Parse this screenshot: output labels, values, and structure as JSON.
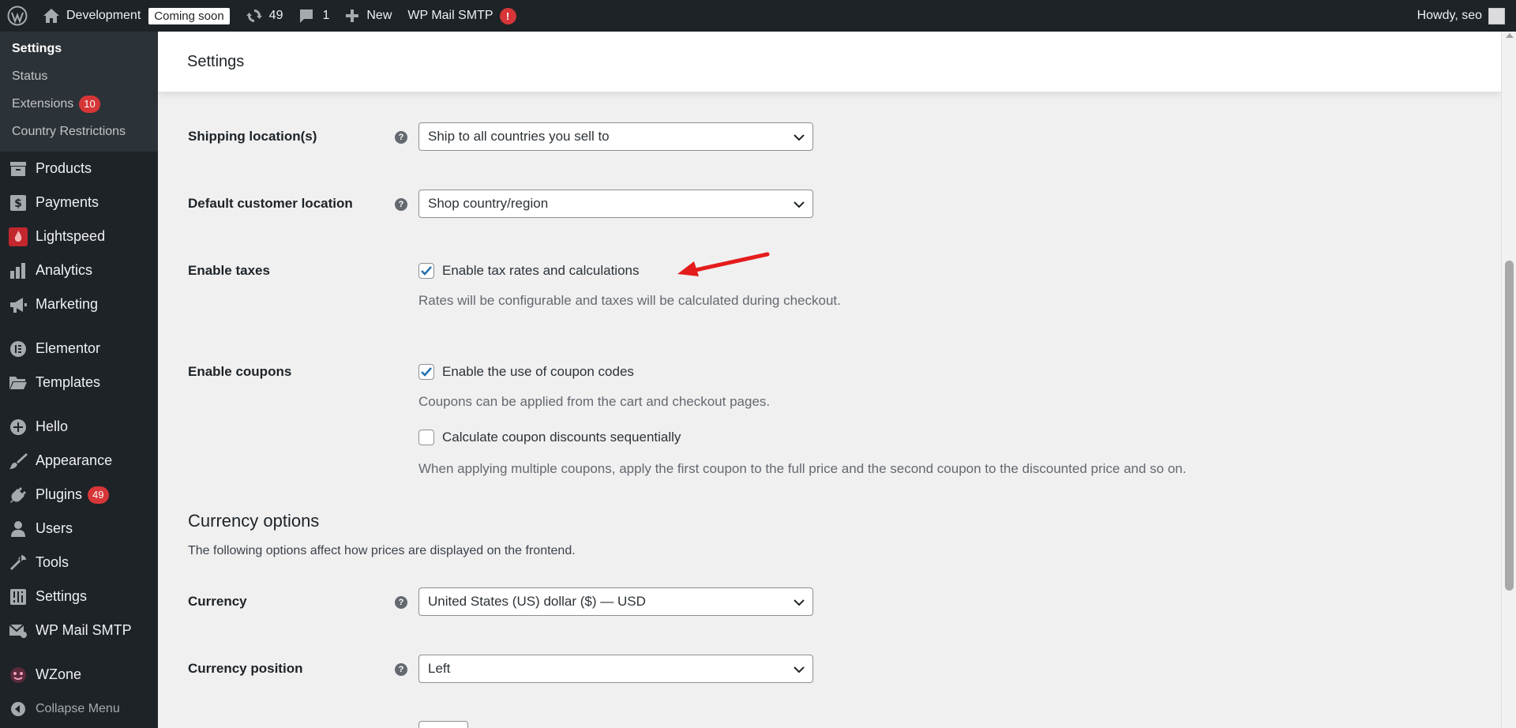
{
  "adminbar": {
    "site_name": "Development",
    "coming_soon": "Coming soon",
    "updates_count": "49",
    "comments_count": "1",
    "new_label": "New",
    "smtp_label": "WP Mail SMTP",
    "smtp_alert": "!",
    "howdy": "Howdy, seo"
  },
  "sidebar": {
    "submenu": [
      {
        "label": "Settings",
        "current": true
      },
      {
        "label": "Status"
      },
      {
        "label": "Extensions",
        "count": "10"
      },
      {
        "label": "Country Restrictions"
      }
    ],
    "menu": [
      {
        "label": "Products",
        "icon": "archive-icon"
      },
      {
        "label": "Payments",
        "icon": "dollar-icon"
      },
      {
        "label": "Lightspeed",
        "icon": "lightspeed-flame-icon"
      },
      {
        "label": "Analytics",
        "icon": "bar-chart-icon"
      },
      {
        "label": "Marketing",
        "icon": "megaphone-icon"
      },
      {
        "label": "Elementor",
        "icon": "elementor-icon"
      },
      {
        "label": "Templates",
        "icon": "folder-icon"
      },
      {
        "label": "Hello",
        "icon": "plus-circle-icon"
      },
      {
        "label": "Appearance",
        "icon": "paintbrush-icon"
      },
      {
        "label": "Plugins",
        "icon": "plug-icon",
        "count": "49"
      },
      {
        "label": "Users",
        "icon": "user-icon"
      },
      {
        "label": "Tools",
        "icon": "wrench-icon"
      },
      {
        "label": "Settings",
        "icon": "sliders-icon"
      },
      {
        "label": "WP Mail SMTP",
        "icon": "mail-icon"
      },
      {
        "label": "WZone",
        "icon": "wzone-icon"
      }
    ],
    "collapse": "Collapse Menu"
  },
  "header": {
    "title": "Settings"
  },
  "form": {
    "shipping_location": {
      "label": "Shipping location(s)",
      "value": "Ship to all countries you sell to"
    },
    "default_location": {
      "label": "Default customer location",
      "value": "Shop country/region"
    },
    "enable_taxes": {
      "label": "Enable taxes",
      "checkbox": "Enable tax rates and calculations",
      "checked": true,
      "desc": "Rates will be configurable and taxes will be calculated during checkout."
    },
    "enable_coupons": {
      "label": "Enable coupons",
      "checkbox": "Enable the use of coupon codes",
      "checked": true,
      "desc": "Coupons can be applied from the cart and checkout pages.",
      "sequential": "Calculate coupon discounts sequentially",
      "sequential_checked": false,
      "sequential_desc": "When applying multiple coupons, apply the first coupon to the full price and the second coupon to the discounted price and so on."
    },
    "currency_options": {
      "title": "Currency options",
      "desc": "The following options affect how prices are displayed on the frontend."
    },
    "currency": {
      "label": "Currency",
      "value": "United States (US) dollar ($) — USD"
    },
    "currency_position": {
      "label": "Currency position",
      "value": "Left"
    }
  },
  "colors": {
    "accent": "#2271b1",
    "badge": "#d63638",
    "arrow": "#e51c1c"
  }
}
